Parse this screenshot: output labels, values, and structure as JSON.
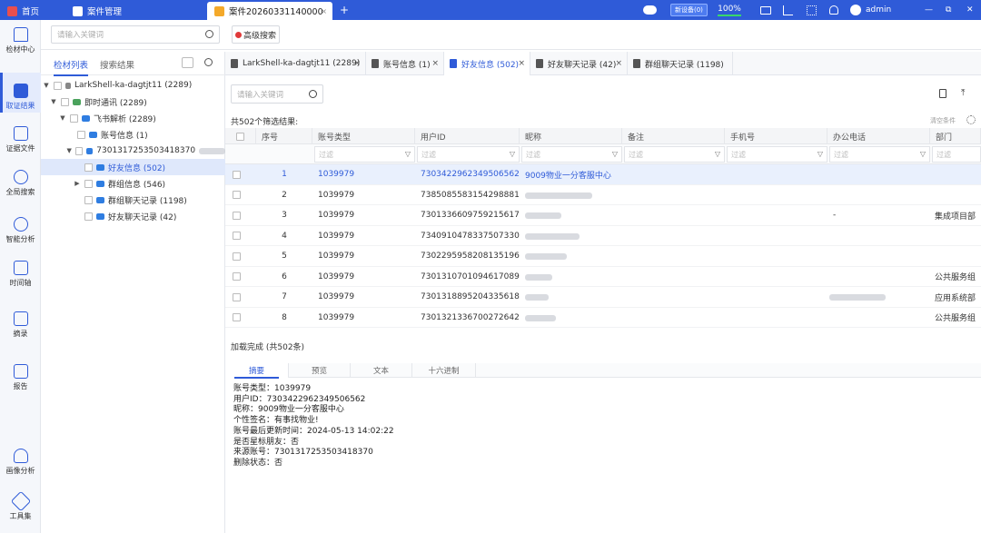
{
  "app_tabs": [
    {
      "label": "首页"
    },
    {
      "label": "案件管理"
    },
    {
      "label": "案件20260331140000",
      "close": "×",
      "add": "+"
    }
  ],
  "titlebar": {
    "status_badge": "新设备(0)",
    "progress": "100%",
    "user": "admin",
    "minimize": "—",
    "restore": "⧉",
    "close": "✕",
    "progress_fraction": 1.0
  },
  "nav": [
    {
      "label": "检材中心",
      "icon": "home-icon"
    },
    {
      "label": "取证结果",
      "icon": "evidence-icon"
    },
    {
      "label": "证据文件",
      "icon": "file-icon"
    },
    {
      "label": "全局搜索",
      "icon": "search-icon"
    },
    {
      "label": "智能分析",
      "icon": "analysis-icon"
    },
    {
      "label": "时间轴",
      "icon": "timeline-icon"
    },
    {
      "label": "摘录",
      "icon": "bookmark-icon"
    },
    {
      "label": "报告",
      "icon": "report-icon"
    },
    {
      "label": "画像分析",
      "icon": "portrait-icon"
    },
    {
      "label": "工具集",
      "icon": "tools-icon"
    }
  ],
  "top_search": {
    "placeholder": "请输入关键词",
    "advanced_label": "高级搜索"
  },
  "tree_tabs": {
    "material_list": "检材列表",
    "search_results": "搜索结果"
  },
  "tree": [
    {
      "label": "LarkShell-ka-dagtjt11 (2289)"
    },
    {
      "label": "即时通讯 (2289)"
    },
    {
      "label": "飞书解析 (2289)"
    },
    {
      "label": "账号信息 (1)"
    },
    {
      "label": "7301317253503418370"
    },
    {
      "label": "好友信息 (502)"
    },
    {
      "label": "群组信息 (546)"
    },
    {
      "label": "群组聊天记录 (1198)"
    },
    {
      "label": "好友聊天记录 (42)"
    }
  ],
  "result_tabs": [
    {
      "label": "LarkShell-ka-dagtjt11 (2289)"
    },
    {
      "label": "账号信息 (1)"
    },
    {
      "label": "好友信息 (502)"
    },
    {
      "label": "好友聊天记录 (42)"
    },
    {
      "label": "群组聊天记录 (1198)"
    }
  ],
  "grid": {
    "search_placeholder": "请输入关键词",
    "result_count": "共502个筛选结果:",
    "clear_conditions": "清空条件",
    "filter_placeholder": "过滤",
    "columns": [
      "序号",
      "账号类型",
      "用户ID",
      "昵称",
      "备注",
      "手机号",
      "办公电话",
      "部门"
    ],
    "rows": [
      {
        "idx": "1",
        "type": "1039979",
        "uid": "7303422962349506562",
        "nick": "9009物业一分客服中心",
        "note": "",
        "phone": "",
        "office": "",
        "dept": ""
      },
      {
        "idx": "2",
        "type": "1039979",
        "uid": "7385085583154298881",
        "nick": "",
        "note": "",
        "phone": "",
        "office": "",
        "dept": ""
      },
      {
        "idx": "3",
        "type": "1039979",
        "uid": "7301336609759215617",
        "nick": "",
        "note": "",
        "phone": "",
        "office": "-",
        "dept": "集成项目部"
      },
      {
        "idx": "4",
        "type": "1039979",
        "uid": "7340910478337507330",
        "nick": "",
        "note": "",
        "phone": "",
        "office": "",
        "dept": ""
      },
      {
        "idx": "5",
        "type": "1039979",
        "uid": "7302295958208135196",
        "nick": "",
        "note": "",
        "phone": "",
        "office": "",
        "dept": ""
      },
      {
        "idx": "6",
        "type": "1039979",
        "uid": "7301310701094617089",
        "nick": "",
        "note": "",
        "phone": "",
        "office": "",
        "dept": "公共服务组"
      },
      {
        "idx": "7",
        "type": "1039979",
        "uid": "7301318895204335618",
        "nick": "",
        "note": "",
        "phone": "",
        "office": "",
        "dept": "应用系统部"
      },
      {
        "idx": "8",
        "type": "1039979",
        "uid": "7301321336700272642",
        "nick": "",
        "note": "",
        "phone": "",
        "office": "",
        "dept": "公共服务组"
      }
    ],
    "load_status": "加载完成 (共502条)"
  },
  "detail_tabs": [
    "摘要",
    "预览",
    "文本",
    "十六进制"
  ],
  "summary": [
    "账号类型：1039979",
    "用户ID：7303422962349506562",
    "昵称：9009物业一分客服中心",
    "个性签名：有事找物业!",
    "账号最后更新时间：2024-05-13 14:02:22",
    "是否星标朋友：否",
    "来源账号：7301317253503418370",
    "删除状态：否"
  ],
  "colors": {
    "accent": "#2f5bd8",
    "titlebar": "#2f5bd8",
    "selected_row": "#e9f0fd",
    "advanced_icon": "#e03a3a"
  }
}
